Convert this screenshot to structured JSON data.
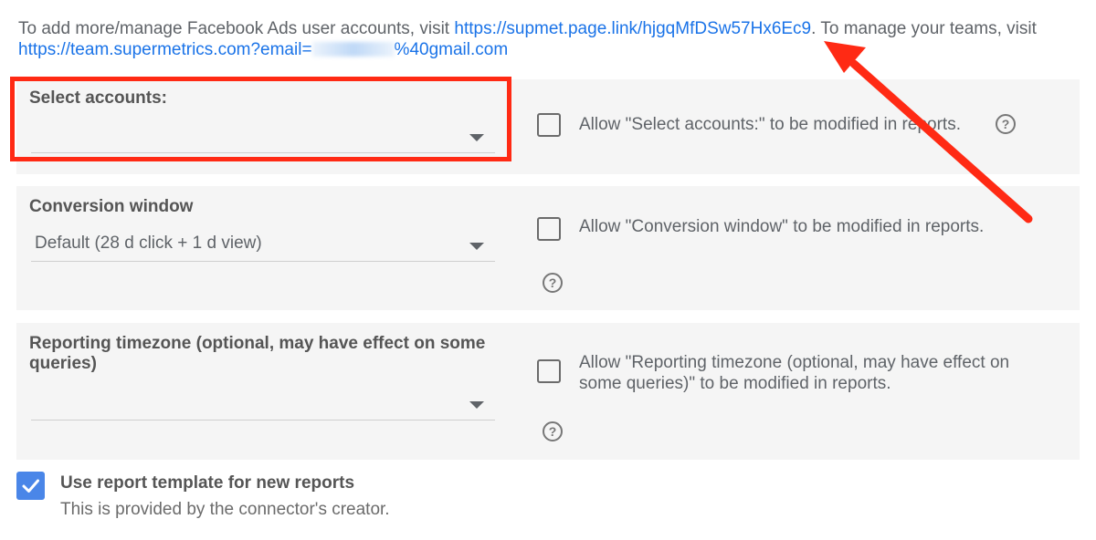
{
  "intro": {
    "text_before": "To add more/manage Facebook Ads user accounts, visit ",
    "accounts_link": "https://supmet.page.link/hjgqMfDSw57Hx6Ec9",
    "text_middle": ". To manage your teams, visit ",
    "team_link_prefix": "https://team.supermetrics.com?email=",
    "team_link_suffix": "%40gmail.com"
  },
  "fields": {
    "select_accounts": {
      "label": "Select accounts:",
      "value": "",
      "allow_text": "Allow \"Select accounts:\" to be modified in reports."
    },
    "conversion_window": {
      "label": "Conversion window",
      "value": "Default (28 d click + 1 d view)",
      "allow_text": "Allow \"Conversion window\" to be modified in reports."
    },
    "reporting_timezone": {
      "label": "Reporting timezone (optional, may have effect on some queries)",
      "value": "",
      "allow_text": "Allow \"Reporting timezone (optional, may have effect on some queries)\" to be modified in reports."
    }
  },
  "template": {
    "label": "Use report template for new reports",
    "sub": "This is provided by the connector's creator.",
    "checked": true
  },
  "icons": {
    "help": "help-circle-icon",
    "caret": "caret-down-icon",
    "check": "check-icon"
  },
  "colors": {
    "link": "#1a73e8",
    "highlight": "#ff2a14",
    "checkbox_checked": "#4a86e8",
    "panel_bg": "#f5f5f5"
  }
}
